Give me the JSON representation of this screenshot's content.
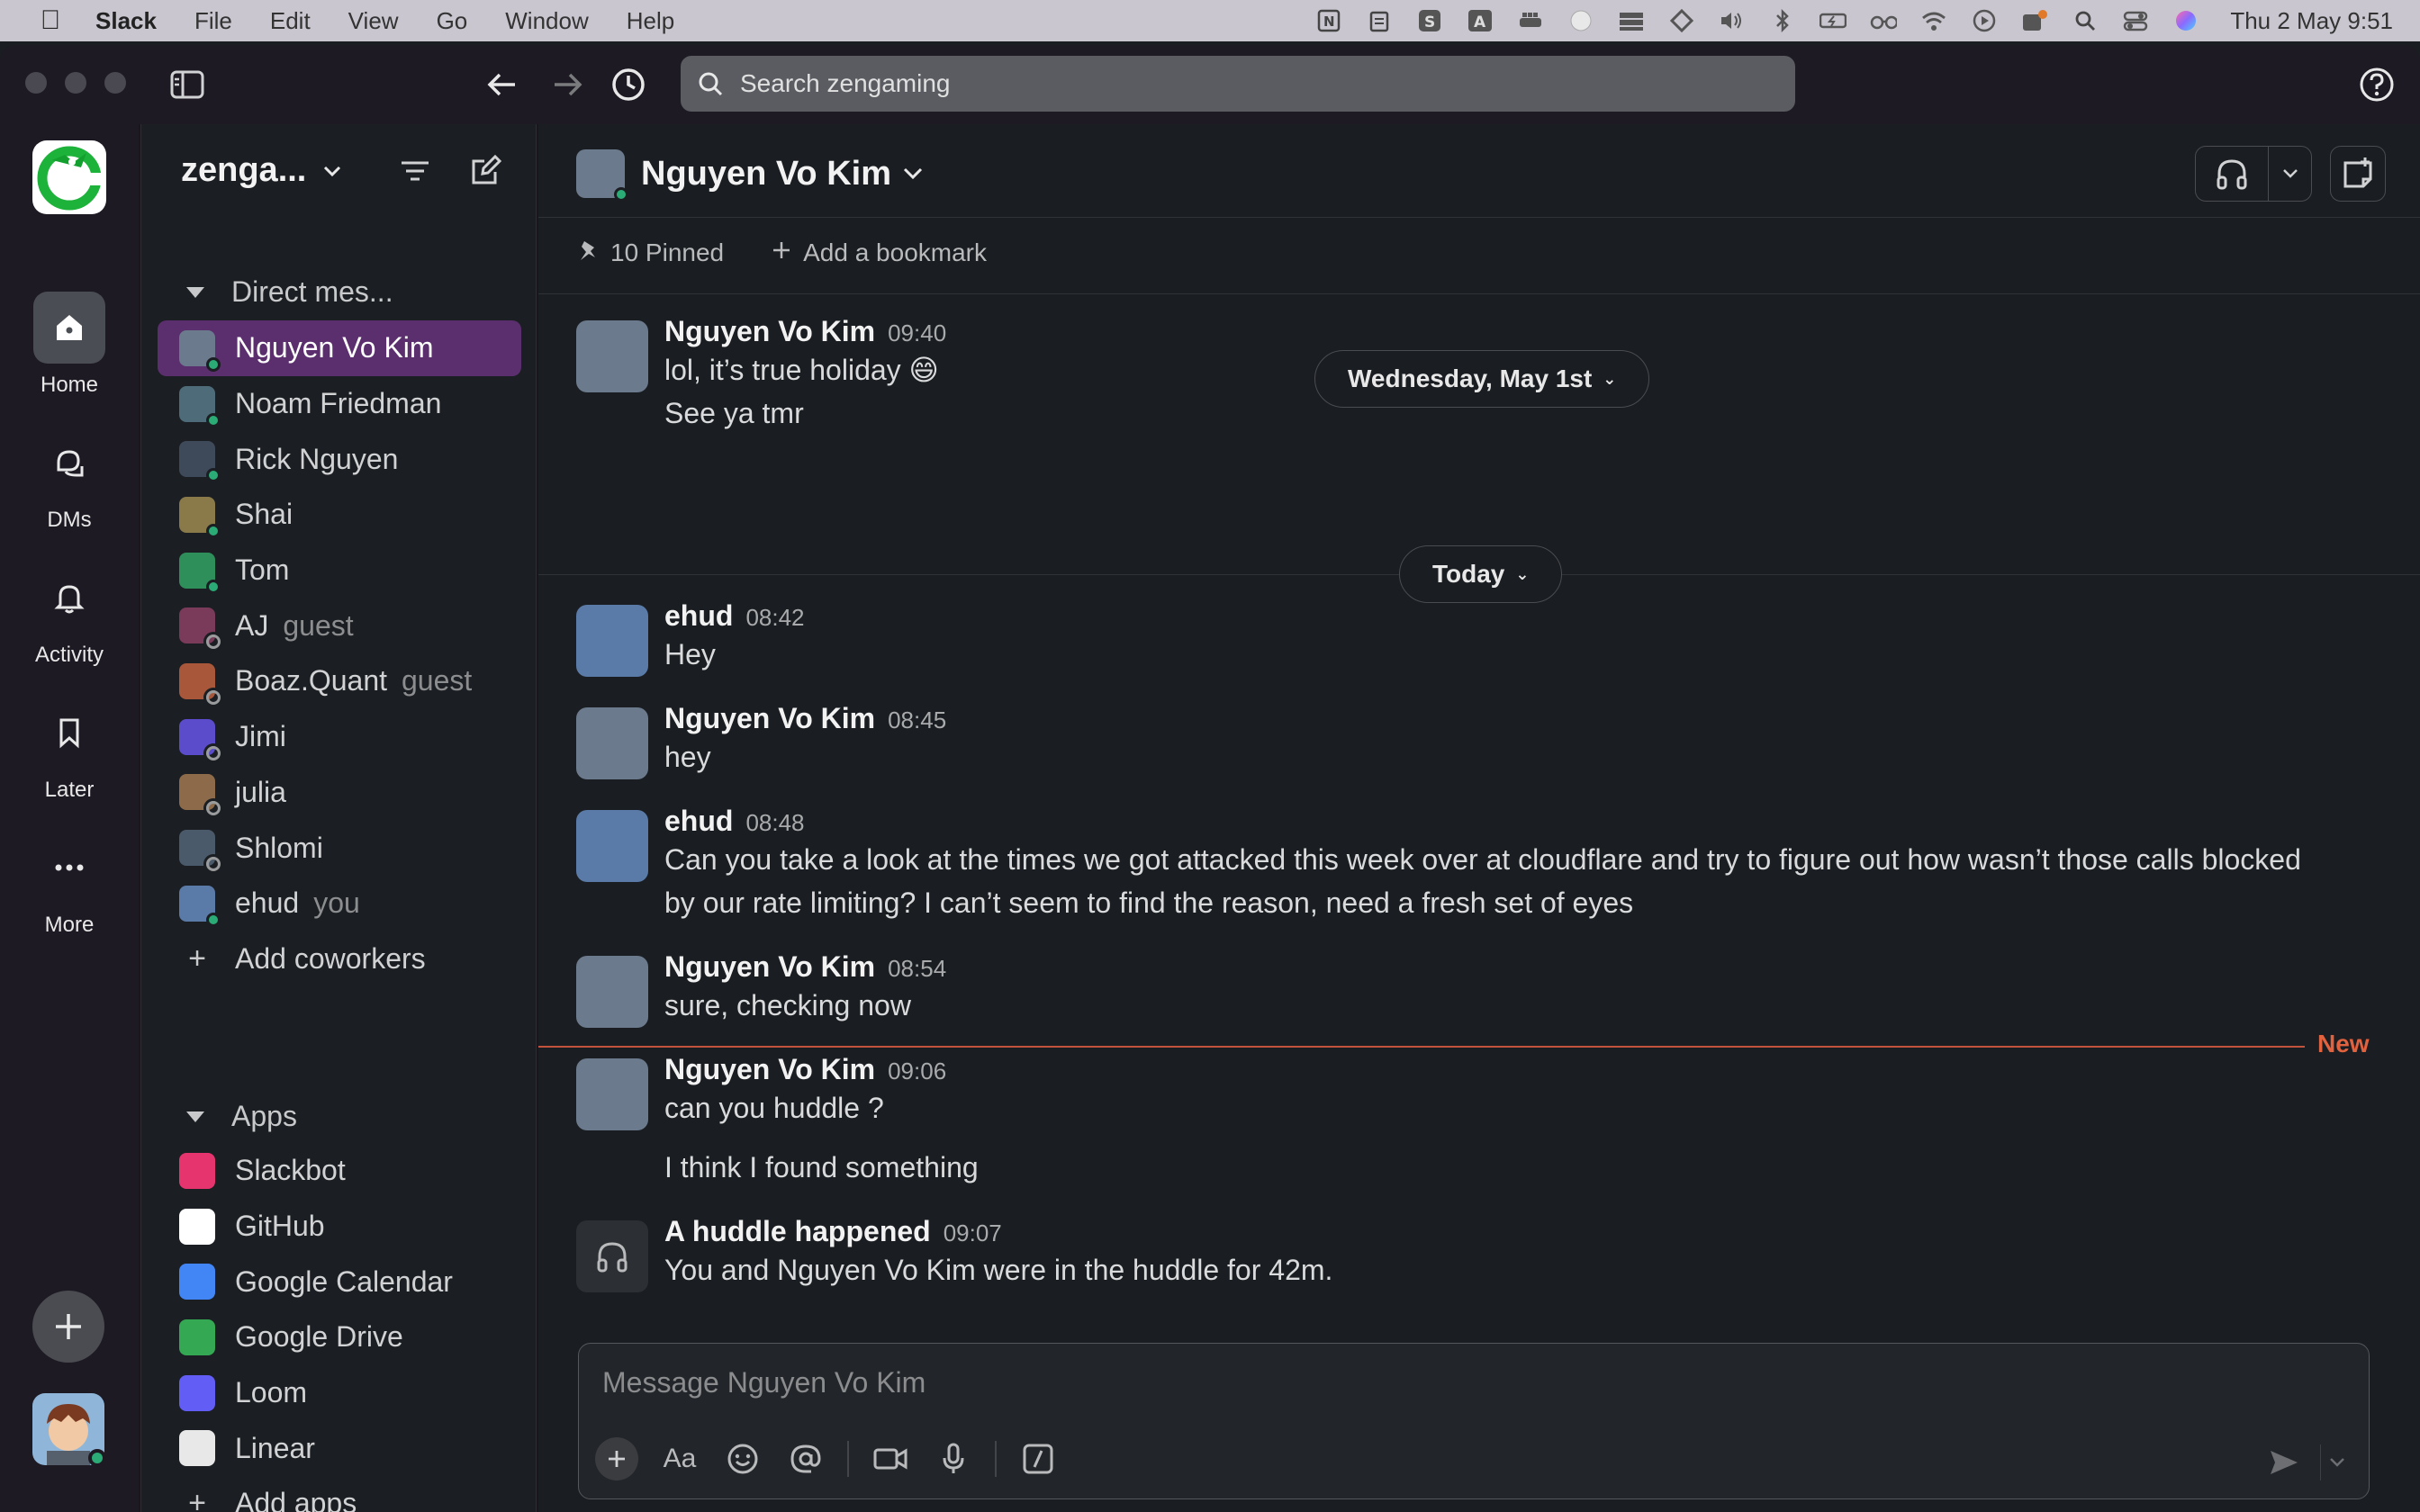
{
  "menubar": {
    "app_name": "Slack",
    "menus": [
      "File",
      "Edit",
      "View",
      "Go",
      "Window",
      "Help"
    ],
    "clock": "Thu 2 May  9:51"
  },
  "topbar": {
    "search_placeholder": "Search zengaming"
  },
  "rail": {
    "items": [
      {
        "label": "Home",
        "icon": "home-icon"
      },
      {
        "label": "DMs",
        "icon": "dms-icon"
      },
      {
        "label": "Activity",
        "icon": "bell-icon"
      },
      {
        "label": "Later",
        "icon": "bookmark-icon"
      },
      {
        "label": "More",
        "icon": "more-icon"
      }
    ]
  },
  "sidebar": {
    "workspace": "zenga...",
    "dm_section": "Direct mes...",
    "dms": [
      {
        "name": "Nguyen Vo Kim",
        "tag": "",
        "color": "#6b7a8c"
      },
      {
        "name": "Noam Friedman",
        "tag": "",
        "color": "#4d6b78"
      },
      {
        "name": "Rick Nguyen",
        "tag": "",
        "color": "#3e4a5a"
      },
      {
        "name": "Shai",
        "tag": "",
        "color": "#8a7a4a"
      },
      {
        "name": "Tom",
        "tag": "",
        "color": "#2f8f5b"
      },
      {
        "name": "AJ",
        "tag": "guest",
        "color": "#7a3a5a"
      },
      {
        "name": "Boaz.Quant",
        "tag": "guest",
        "color": "#a8573a"
      },
      {
        "name": "Jimi",
        "tag": "",
        "color": "#5b4ccc"
      },
      {
        "name": "julia",
        "tag": "",
        "color": "#8c6a4a"
      },
      {
        "name": "Shlomi",
        "tag": "",
        "color": "#4a5a6a"
      },
      {
        "name": "ehud",
        "tag": "you",
        "color": "#5a7aa8"
      }
    ],
    "add_coworkers": "Add coworkers",
    "apps_section": "Apps",
    "apps": [
      {
        "name": "Slackbot",
        "color": "#e6356e"
      },
      {
        "name": "GitHub",
        "color": "#ffffff"
      },
      {
        "name": "Google Calendar",
        "color": "#4285f4"
      },
      {
        "name": "Google Drive",
        "color": "#34a853"
      },
      {
        "name": "Loom",
        "color": "#625df5"
      },
      {
        "name": "Linear",
        "color": "#e8e8e8"
      }
    ],
    "add_apps": "Add apps"
  },
  "channel": {
    "title": "Nguyen Vo Kim",
    "pinned": "10 Pinned",
    "add_bookmark": "Add a bookmark"
  },
  "dividers": {
    "first": "Wednesday, May 1st",
    "second": "Today",
    "new_label": "New"
  },
  "messages": [
    {
      "author": "Nguyen Vo Kim",
      "time": "09:40",
      "lines": [
        "lol, it’s true holiday 😄",
        "See ya tmr"
      ]
    },
    {
      "author": "ehud",
      "time": "08:42",
      "lines": [
        "Hey"
      ]
    },
    {
      "author": "Nguyen Vo Kim",
      "time": "08:45",
      "lines": [
        "hey"
      ]
    },
    {
      "author": "ehud",
      "time": "08:48",
      "lines": [
        "Can you take a look at the times we got attacked this week over at cloudflare and try to figure out how wasn’t those calls blocked",
        "by our rate limiting? I can’t seem to find the reason, need a fresh set of eyes"
      ]
    },
    {
      "author": "Nguyen Vo Kim",
      "time": "08:54",
      "lines": [
        "sure, checking now"
      ]
    },
    {
      "author": "Nguyen Vo Kim",
      "time": "09:06",
      "lines": [
        "can you huddle ?",
        "I think I found something"
      ]
    },
    {
      "author": "A huddle happened",
      "time": "09:07",
      "lines": [
        "You and Nguyen Vo Kim were in the huddle for 42m."
      ]
    }
  ],
  "composer": {
    "placeholder": "Message Nguyen Vo Kim",
    "format_label": "Aa"
  }
}
